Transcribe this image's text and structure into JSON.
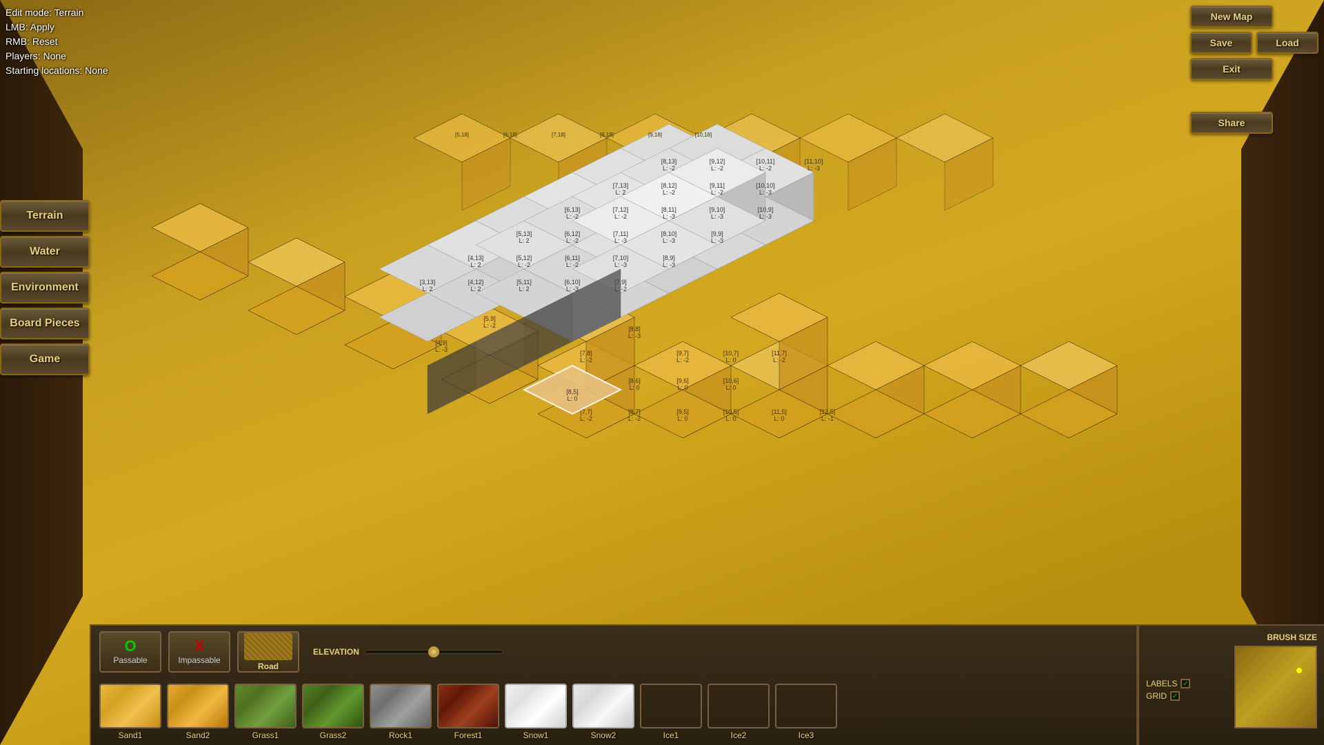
{
  "info": {
    "edit_mode": "Edit mode: Terrain",
    "lmb": "LMB: Apply",
    "rmb": "RMB: Reset",
    "players": "Players: None",
    "starting_locations": "Starting locations: None"
  },
  "top_right": {
    "new_map": "New Map",
    "save": "Save",
    "load": "Load",
    "exit": "Exit",
    "share": "Share"
  },
  "sidebar": {
    "terrain": "Terrain",
    "water": "Water",
    "environment": "Environment",
    "board_pieces": "Board Pieces",
    "game": "Game"
  },
  "bottom_toolbar": {
    "passable_label": "Passable",
    "impassable_label": "Impassable",
    "road_label": "Road",
    "passable_icon": "O",
    "impassable_icon": "X",
    "elevation_label": "ELEVATION"
  },
  "tiles": [
    {
      "id": "sand1",
      "label": "Sand1",
      "class": "sand1"
    },
    {
      "id": "sand2",
      "label": "Sand2",
      "class": "sand2"
    },
    {
      "id": "grass1",
      "label": "Grass1",
      "class": "grass1"
    },
    {
      "id": "grass2",
      "label": "Grass2",
      "class": "grass2"
    },
    {
      "id": "rock1",
      "label": "Rock1",
      "class": "rock1"
    },
    {
      "id": "forest1",
      "label": "Forest1",
      "class": "forest1"
    },
    {
      "id": "snow1",
      "label": "Snow1",
      "class": "snow1"
    },
    {
      "id": "snow2",
      "label": "Snow2",
      "class": "snow2"
    },
    {
      "id": "ice1",
      "label": "Ice1",
      "class": "ice1"
    },
    {
      "id": "ice2",
      "label": "Ice2",
      "class": "ice2"
    },
    {
      "id": "ice3",
      "label": "Ice3",
      "class": "ice3"
    }
  ],
  "bottom_right": {
    "brush_size_label": "BRUSH SIZE",
    "labels_label": "LABELS",
    "grid_label": "GRID"
  }
}
